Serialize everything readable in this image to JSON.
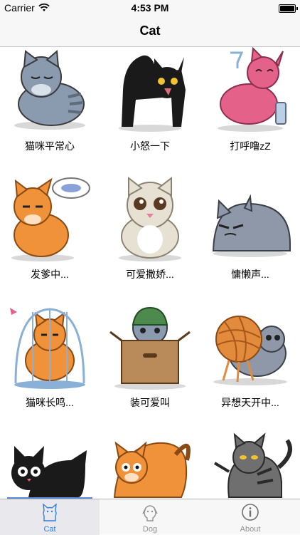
{
  "status_bar": {
    "carrier": "Carrier",
    "time": "4:53 PM"
  },
  "nav": {
    "title": "Cat"
  },
  "cats": [
    {
      "label": "猫咪平常心",
      "icon": "sleepy-gray-cat-icon",
      "color": "#8a9bb0"
    },
    {
      "label": "小怒一下",
      "icon": "angry-black-cat-icon",
      "color": "#1a1a1a"
    },
    {
      "label": "打呼噜zZ",
      "icon": "drunk-pink-cat-icon",
      "color": "#e4628a"
    },
    {
      "label": "发爹中...",
      "icon": "daydreaming-orange-cat-icon",
      "color": "#f0923a"
    },
    {
      "label": "可爱撒娇...",
      "icon": "cute-cream-cat-icon",
      "color": "#e7e1d3"
    },
    {
      "label": "慵懒声...",
      "icon": "lazy-gray-cat-icon",
      "color": "#8e98a8"
    },
    {
      "label": "猫咪长鸣...",
      "icon": "caged-orange-cat-icon",
      "color": "#f0923a"
    },
    {
      "label": "装可爱叫",
      "icon": "cat-in-box-icon",
      "color": "#b98b5a"
    },
    {
      "label": "异想天开中...",
      "icon": "yarn-ball-cat-icon",
      "color": "#e28b3c"
    },
    {
      "label": "",
      "icon": "black-cat-litter-icon",
      "color": "#1a1a1a"
    },
    {
      "label": "",
      "icon": "orange-cat-stretch-icon",
      "color": "#f0923a"
    },
    {
      "label": "",
      "icon": "tabby-gray-cat-icon",
      "color": "#6f6f6f"
    }
  ],
  "tabs": [
    {
      "label": "Cat",
      "icon": "cat-tab-icon",
      "active": true
    },
    {
      "label": "Dog",
      "icon": "dog-tab-icon",
      "active": false
    },
    {
      "label": "About",
      "icon": "info-icon",
      "active": false
    }
  ],
  "colors": {
    "accent": "#2f7fd8",
    "bar_bg": "#f7f7f7",
    "inactive": "#929292"
  }
}
